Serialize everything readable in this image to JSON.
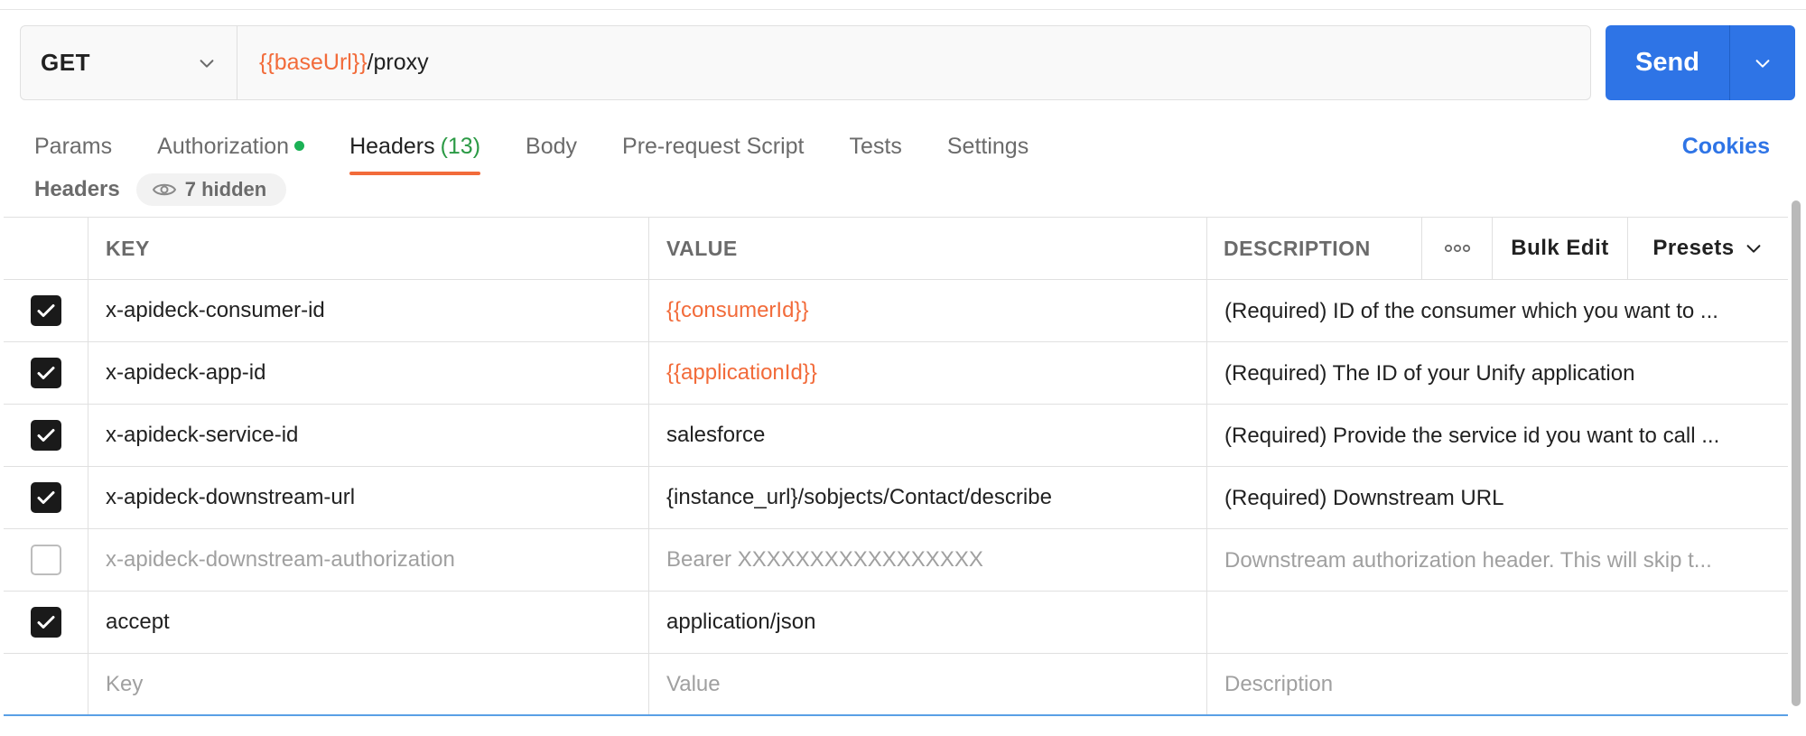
{
  "request": {
    "method": "GET",
    "url_var": "{{baseUrl}}",
    "url_path": "/proxy",
    "send_label": "Send"
  },
  "tabs": [
    {
      "label": "Params"
    },
    {
      "label": "Authorization",
      "status_dot": true
    },
    {
      "label": "Headers",
      "count": "(13)",
      "active": true
    },
    {
      "label": "Body"
    },
    {
      "label": "Pre-request Script"
    },
    {
      "label": "Tests"
    },
    {
      "label": "Settings"
    }
  ],
  "cookies_label": "Cookies",
  "headers_section": {
    "title": "Headers",
    "hidden_label": "7 hidden"
  },
  "table": {
    "columns": {
      "key": "KEY",
      "value": "VALUE",
      "description": "DESCRIPTION",
      "bulk_edit": "Bulk Edit",
      "presets": "Presets"
    },
    "rows": [
      {
        "checked": true,
        "key": "x-apideck-consumer-id",
        "value": "{{consumerId}}",
        "value_is_var": true,
        "description": "(Required) ID of the consumer which you want to ..."
      },
      {
        "checked": true,
        "key": "x-apideck-app-id",
        "value": "{{applicationId}}",
        "value_is_var": true,
        "description": "(Required) The ID of your Unify application"
      },
      {
        "checked": true,
        "key": "x-apideck-service-id",
        "value": "salesforce",
        "value_is_var": false,
        "description": "(Required) Provide the service id you want to call ..."
      },
      {
        "checked": true,
        "key": "x-apideck-downstream-url",
        "value": "{instance_url}/sobjects/Contact/describe",
        "value_is_var": false,
        "description": "(Required) Downstream URL"
      },
      {
        "checked": false,
        "key": "x-apideck-downstream-authorization",
        "value": "Bearer XXXXXXXXXXXXXXXXX",
        "value_is_var": false,
        "description": "Downstream authorization header. This will skip t..."
      },
      {
        "checked": true,
        "key": "accept",
        "value": "application/json",
        "value_is_var": false,
        "description": ""
      }
    ],
    "new_row": {
      "key_placeholder": "Key",
      "value_placeholder": "Value",
      "description_placeholder": "Description"
    }
  },
  "colors": {
    "accent": "#f26b3a",
    "primary": "#2e74e6",
    "success": "#1bb155"
  },
  "icons": {
    "method_dropdown": "chevron-down-icon",
    "send_dropdown": "chevron-down-icon",
    "hidden": "eye-icon",
    "more": "ellipsis-icon",
    "check": "check-icon"
  }
}
